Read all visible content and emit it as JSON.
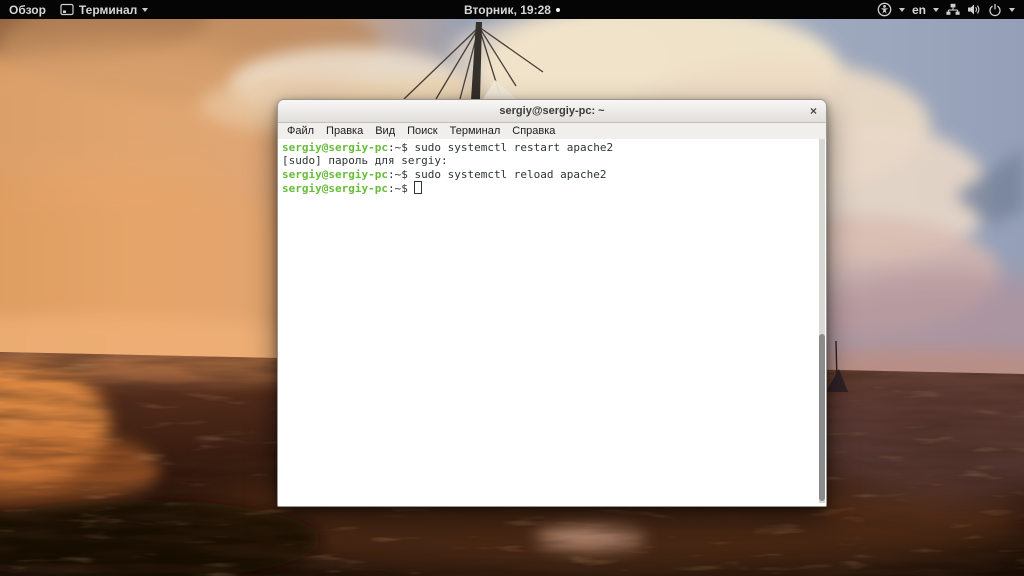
{
  "top_bar": {
    "activities": "Обзор",
    "app_name": "Терминал",
    "clock": "Вторник, 19:28",
    "language": "en"
  },
  "window": {
    "title": "sergiy@sergiy-pc: ~",
    "close": "×",
    "menu": [
      "Файл",
      "Правка",
      "Вид",
      "Поиск",
      "Терминал",
      "Справка"
    ],
    "terminal": {
      "lines": [
        {
          "user_host": "sergiy@sergiy-pc",
          "prompt_suffix": ":~$ ",
          "text": "sudo systemctl restart apache2"
        },
        {
          "user_host": "",
          "prompt_suffix": "",
          "text": "[sudo] пароль для sergiy:"
        },
        {
          "user_host": "sergiy@sergiy-pc",
          "prompt_suffix": ":~$ ",
          "text": "sudo systemctl reload apache2"
        },
        {
          "user_host": "sergiy@sergiy-pc",
          "prompt_suffix": ":~$ ",
          "text": ""
        }
      ]
    }
  },
  "colors": {
    "prompt_green": "#67bd3a",
    "terminal_fg": "#2e3436",
    "terminal_bg": "#ffffff",
    "topbar_bg": "#050505",
    "topbar_fg": "#d6d6d6",
    "titlebar_bg": "#efedea"
  }
}
